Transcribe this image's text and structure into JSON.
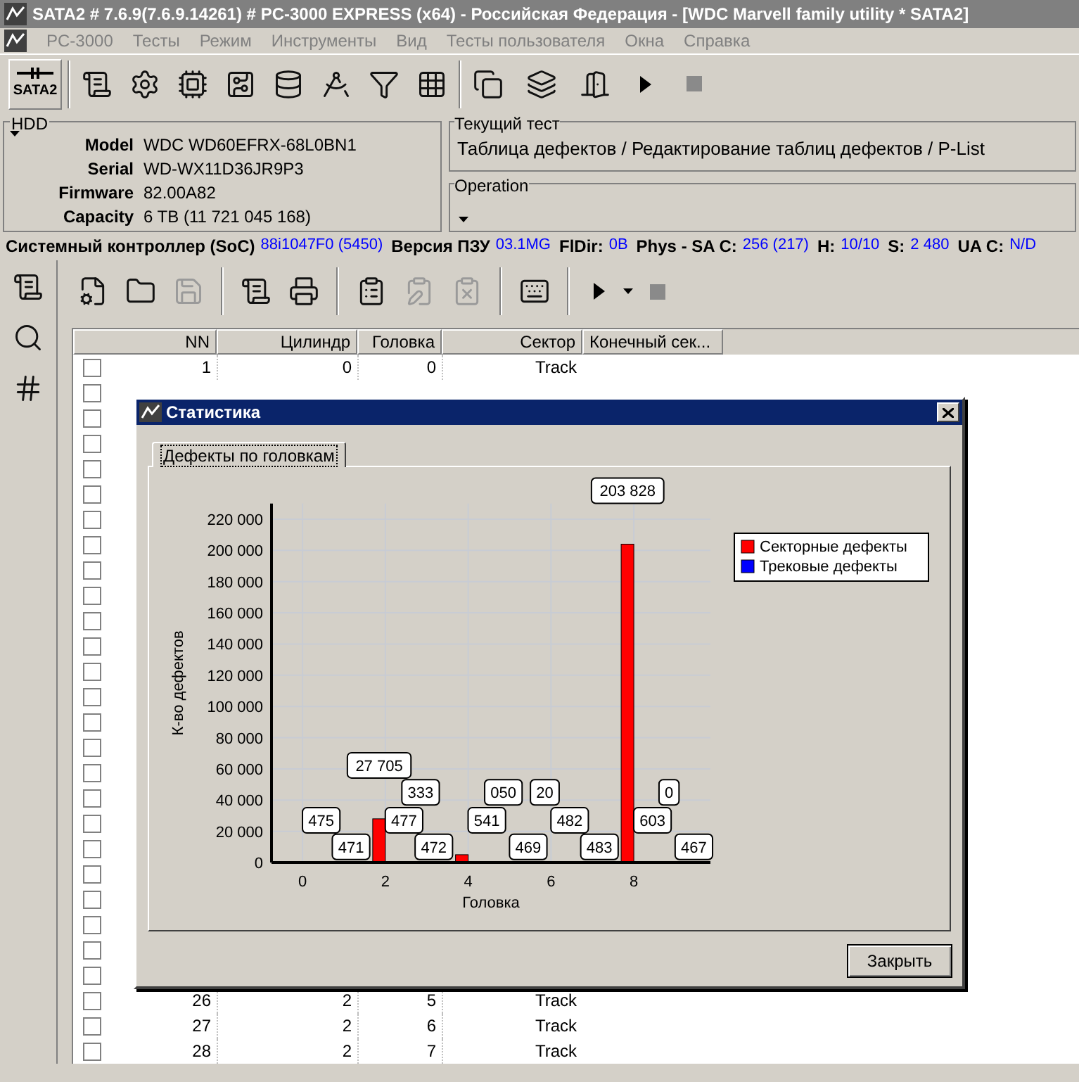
{
  "window": {
    "title": "SATA2 # 7.6.9(7.6.9.14261) # PC-3000 EXPRESS (x64) - Российская Федерация - [WDC Marvell family utility * SATA2]"
  },
  "menu": [
    "PC-3000",
    "Тесты",
    "Режим",
    "Инструменты",
    "Вид",
    "Тесты пользователя",
    "Окна",
    "Справка"
  ],
  "toolbar": {
    "port_label": "SATA2"
  },
  "hdd": {
    "title": "HDD",
    "fields": [
      {
        "label": "Model",
        "value": "WDC WD60EFRX-68L0BN1"
      },
      {
        "label": "Serial",
        "value": "WD-WX11D36JR9P3"
      },
      {
        "label": "Firmware",
        "value": "82.00A82"
      },
      {
        "label": "Capacity",
        "value": "6 TB (11 721 045 168)"
      }
    ]
  },
  "current_test": {
    "title": "Текущий тест",
    "value": "Таблица дефектов / Редактирование таблиц дефектов / P-List"
  },
  "operation": {
    "title": "Operation"
  },
  "status": [
    {
      "label": "Системный контроллер (SoC)",
      "value": "88i1047F0 (5450)"
    },
    {
      "label": "Версия ПЗУ",
      "value": "03.1MG"
    },
    {
      "label": "FlDir:",
      "value": "0B"
    },
    {
      "label": "Phys - SA C:",
      "value": "256 (217)"
    },
    {
      "label": "H:",
      "value": "10/10"
    },
    {
      "label": "S:",
      "value": "2 480"
    },
    {
      "label": "UA C:",
      "value": "N/D"
    }
  ],
  "table": {
    "columns": [
      "NN",
      "Цилиндр",
      "Головка",
      "Сектор",
      "Конечный сек..."
    ],
    "rows": [
      {
        "checked": false,
        "cells": [
          "1",
          "0",
          "0",
          "Track"
        ]
      },
      {
        "checked": false
      },
      {
        "checked": false
      },
      {
        "checked": false
      },
      {
        "checked": false
      },
      {
        "checked": false
      },
      {
        "checked": false
      },
      {
        "checked": false
      },
      {
        "checked": false
      },
      {
        "checked": false
      },
      {
        "checked": false
      },
      {
        "checked": false
      },
      {
        "checked": false
      },
      {
        "checked": false
      },
      {
        "checked": false
      },
      {
        "checked": false
      },
      {
        "checked": false
      },
      {
        "checked": false
      },
      {
        "checked": false
      },
      {
        "checked": false
      },
      {
        "checked": false
      },
      {
        "checked": false
      },
      {
        "checked": false
      },
      {
        "checked": false
      },
      {
        "checked": false
      },
      {
        "checked": false,
        "cells": [
          "26",
          "2",
          "5",
          "Track"
        ]
      },
      {
        "checked": false,
        "cells": [
          "27",
          "2",
          "6",
          "Track"
        ]
      },
      {
        "checked": false,
        "cells": [
          "28",
          "2",
          "7",
          "Track"
        ]
      }
    ]
  },
  "dialog": {
    "title": "Статистика",
    "tabs": [
      {
        "label": "Дефекты по головкам",
        "selected": true
      }
    ],
    "chart_data": {
      "type": "bar",
      "xlabel": "Головка",
      "ylabel": "К-во дефектов",
      "x": [
        0,
        1,
        2,
        3,
        4,
        5,
        6,
        7,
        8,
        9
      ],
      "series": [
        {
          "name": "Секторные дефекты",
          "color": "#ff0000",
          "values": [
            null,
            0,
            28000,
            null,
            5000,
            null,
            0,
            0,
            204000,
            0
          ]
        },
        {
          "name": "Трековые дефекты",
          "color": "#0000ff",
          "values": [
            500,
            500,
            500,
            500,
            500,
            500,
            500,
            500,
            600,
            500
          ]
        }
      ],
      "xlim": [
        -0.75,
        9.85
      ],
      "ylim": [
        0,
        230000
      ],
      "xticks": [
        0,
        2,
        4,
        6,
        8
      ],
      "yticks": [
        {
          "value": 0,
          "label": "0"
        },
        {
          "value": 20000,
          "label": "20 000"
        },
        {
          "value": 40000,
          "label": "40 000"
        },
        {
          "value": 60000,
          "label": "60 000"
        },
        {
          "value": 80000,
          "label": "80 000"
        },
        {
          "value": 100000,
          "label": "100 000"
        },
        {
          "value": 120000,
          "label": "120 000"
        },
        {
          "value": 140000,
          "label": "140 000"
        },
        {
          "value": 160000,
          "label": "160 000"
        },
        {
          "value": 180000,
          "label": "180 000"
        },
        {
          "value": 200000,
          "label": "200 000"
        },
        {
          "value": 220000,
          "label": "220 000"
        }
      ],
      "grid": true,
      "legend": true,
      "annotations": [
        {
          "x": 0.45,
          "y": 27000,
          "text": "475"
        },
        {
          "x": 1.17,
          "y": 10000,
          "text": "471"
        },
        {
          "x": 1.85,
          "y": 28000,
          "text": "27 705"
        },
        {
          "x": 2.45,
          "y": 27000,
          "text": "477"
        },
        {
          "x": 2.85,
          "y": 45000,
          "text": "333"
        },
        {
          "x": 3.17,
          "y": 10000,
          "text": "472"
        },
        {
          "x": 4.45,
          "y": 27000,
          "text": "541"
        },
        {
          "x": 4.85,
          "y": 45000,
          "text": "050"
        },
        {
          "x": 5.45,
          "y": 10000,
          "text": "469"
        },
        {
          "x": 5.85,
          "y": 45000,
          "text": "20"
        },
        {
          "x": 6.45,
          "y": 27000,
          "text": "482"
        },
        {
          "x": 7.17,
          "y": 10000,
          "text": "483"
        },
        {
          "x": 7.85,
          "y": 204000,
          "text": "203 828"
        },
        {
          "x": 8.45,
          "y": 27000,
          "text": "603"
        },
        {
          "x": 8.85,
          "y": 45000,
          "text": "0"
        },
        {
          "x": 9.45,
          "y": 10000,
          "text": "467"
        }
      ]
    },
    "buttons": [
      "Закрыть"
    ]
  }
}
